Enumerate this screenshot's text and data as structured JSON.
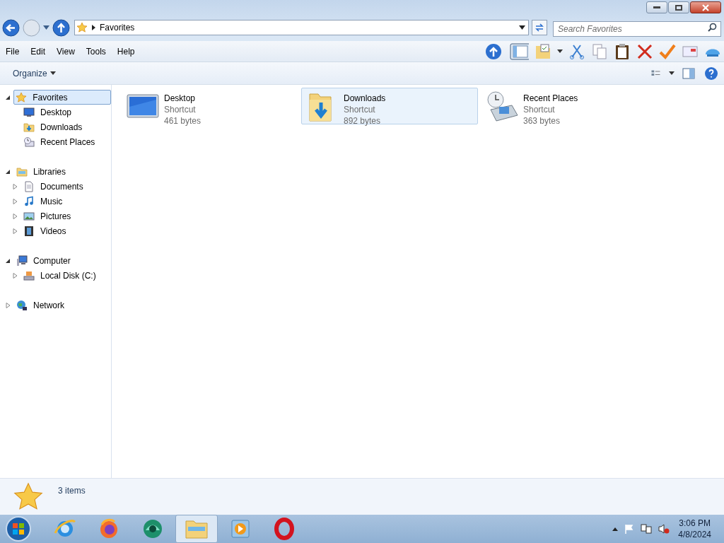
{
  "address": {
    "path": "Favorites"
  },
  "search": {
    "placeholder": "Search Favorites"
  },
  "menu": [
    "File",
    "Edit",
    "View",
    "Tools",
    "Help"
  ],
  "command_bar": {
    "organize": "Organize"
  },
  "sidebar": [
    {
      "label": "Favorites",
      "kind": "branch",
      "expanded": true,
      "selected": true,
      "children": [
        {
          "label": "Desktop",
          "kind": "leaf",
          "selected": false
        },
        {
          "label": "Downloads",
          "kind": "leaf",
          "selected": false
        },
        {
          "label": "Recent Places",
          "kind": "leaf",
          "selected": false
        }
      ]
    },
    {
      "label": "Libraries",
      "kind": "branch",
      "expanded": true,
      "selected": false,
      "children": [
        {
          "label": "Documents",
          "kind": "branch",
          "expanded": false,
          "selected": false
        },
        {
          "label": "Music",
          "kind": "branch",
          "expanded": false,
          "selected": false
        },
        {
          "label": "Pictures",
          "kind": "branch",
          "expanded": false,
          "selected": false
        },
        {
          "label": "Videos",
          "kind": "branch",
          "expanded": false,
          "selected": false
        }
      ]
    },
    {
      "label": "Computer",
      "kind": "branch",
      "expanded": true,
      "selected": false,
      "children": [
        {
          "label": "Local Disk (C:)",
          "kind": "branch",
          "expanded": false,
          "selected": false
        }
      ]
    },
    {
      "label": "Network",
      "kind": "branch",
      "expanded": false,
      "selected": false
    }
  ],
  "files": [
    {
      "name": "Desktop",
      "type": "Shortcut",
      "size": "461 bytes",
      "selected": false
    },
    {
      "name": "Downloads",
      "type": "Shortcut",
      "size": "892 bytes",
      "selected": true
    },
    {
      "name": "Recent Places",
      "type": "Shortcut",
      "size": "363 bytes",
      "selected": false
    }
  ],
  "details": {
    "count": "3 items"
  },
  "taskbar": {
    "apps": [
      {
        "selected": false
      },
      {
        "selected": false
      },
      {
        "selected": false
      },
      {
        "selected": true
      },
      {
        "selected": false
      },
      {
        "selected": false
      }
    ],
    "time": "3:06 PM",
    "date": "4/8/2024"
  }
}
